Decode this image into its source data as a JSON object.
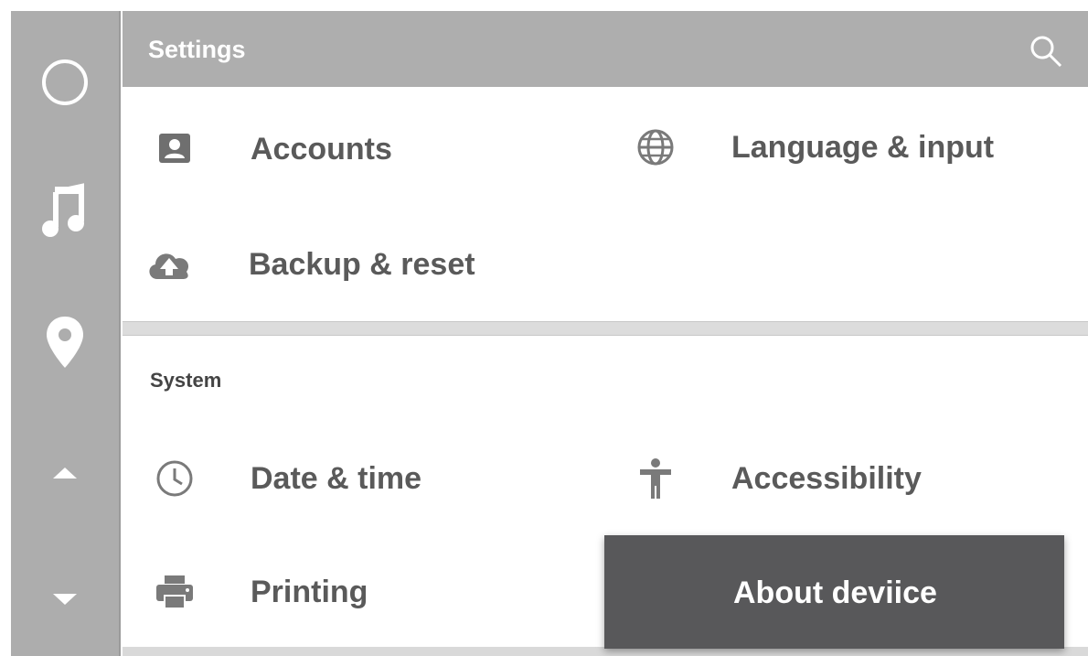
{
  "header": {
    "title": "Settings"
  },
  "rail": {
    "items": [
      {
        "icon": "home-circle-icon"
      },
      {
        "icon": "music-note-icon"
      },
      {
        "icon": "location-pin-icon"
      },
      {
        "icon": "scroll-up-icon"
      },
      {
        "icon": "scroll-down-icon"
      }
    ]
  },
  "personal": {
    "items": [
      {
        "label": "Accounts",
        "icon": "account-icon"
      },
      {
        "label": "Language & input",
        "icon": "globe-icon"
      },
      {
        "label": "Backup & reset",
        "icon": "cloud-upload-icon"
      }
    ]
  },
  "system": {
    "label": "System",
    "items": [
      {
        "label": "Date & time",
        "icon": "clock-icon"
      },
      {
        "label": "Accessibility",
        "icon": "accessibility-icon"
      },
      {
        "label": "Printing",
        "icon": "printer-icon"
      }
    ]
  },
  "toast": {
    "label": "About deviice"
  }
}
